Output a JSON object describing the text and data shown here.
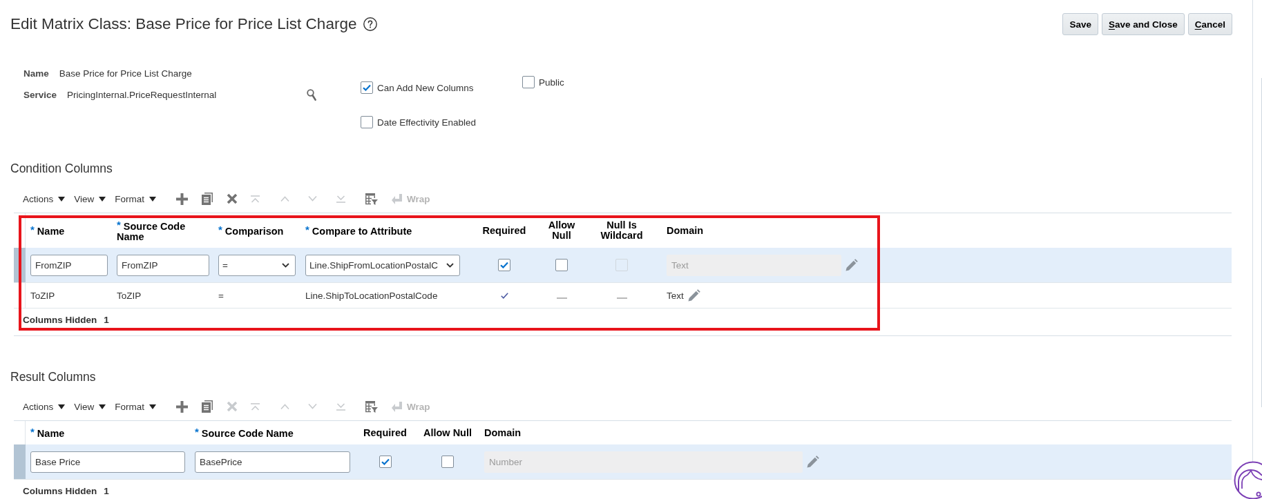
{
  "page": {
    "title": "Edit Matrix Class: Base Price for Price List Charge"
  },
  "buttons": [
    {
      "label": "Save",
      "mnemonic": false
    },
    {
      "label": "Save and Close",
      "mnemonic": true
    },
    {
      "label": "Cancel",
      "mnemonic": true
    }
  ],
  "form": {
    "fields": [
      {
        "kind": "text",
        "label": "Name",
        "value": "Base Price for Price List Charge"
      },
      {
        "kind": "lookup",
        "label": "Service",
        "value": "PricingInternal.PriceRequestInternal"
      }
    ],
    "option_groups": [
      {
        "options": [
          {
            "label": "Can Add New Columns",
            "checked": true
          },
          {
            "label": "Date Effectivity Enabled",
            "checked": false
          }
        ]
      },
      {
        "options": [
          {
            "label": "Public",
            "checked": false
          }
        ]
      }
    ]
  },
  "condition_columns": {
    "title": "Condition Columns",
    "highlighted": true,
    "toolbar": {
      "menus": [
        "Actions",
        "View",
        "Format"
      ],
      "tools": [
        {
          "kind": "add",
          "disabled": false
        },
        {
          "kind": "duplicate",
          "disabled": false
        },
        {
          "kind": "delete",
          "disabled": false
        },
        {
          "kind": "move_top",
          "disabled": true
        },
        {
          "kind": "move_up",
          "disabled": true
        },
        {
          "kind": "move_down",
          "disabled": true
        },
        {
          "kind": "move_bottom",
          "disabled": true
        },
        {
          "kind": "freeze",
          "disabled": false
        }
      ],
      "wrap": {
        "label": "Wrap",
        "disabled": true
      }
    },
    "columns": [
      {
        "kind": "text",
        "marker": "*",
        "label": "Name"
      },
      {
        "kind": "text",
        "marker": "*",
        "label": "Source Code Name"
      },
      {
        "kind": "select",
        "marker": "*",
        "label": "Comparison"
      },
      {
        "kind": "select",
        "marker": "*",
        "label": "Compare to Attribute"
      },
      {
        "kind": "check",
        "label": "Required"
      },
      {
        "kind": "check",
        "label": "Allow Null"
      },
      {
        "kind": "check",
        "label": "Null Is Wildcard"
      },
      {
        "kind": "domain",
        "label": "Domain"
      }
    ],
    "rows": [
      {
        "selected": true,
        "cells": [
          {
            "value": "FromZIP"
          },
          {
            "value": "FromZIP"
          },
          {
            "value": "="
          },
          {
            "value": "Line.ShipFromLocationPostalC"
          },
          {
            "checked": true,
            "disabled": false
          },
          {
            "checked": false,
            "disabled": false
          },
          {
            "checked": false,
            "disabled": true
          },
          {
            "value": "Text"
          }
        ]
      },
      {
        "selected": false,
        "cells": [
          {
            "value": "ToZIP"
          },
          {
            "value": "ToZIP"
          },
          {
            "value": "="
          },
          {
            "value": "Line.ShipToLocationPostalCode"
          },
          {
            "checked": true,
            "disabled": false
          },
          {
            "checked": false,
            "disabled": false
          },
          {
            "checked": false,
            "disabled": false
          },
          {
            "value": "Text"
          }
        ]
      }
    ],
    "footer": {
      "label": "Columns Hidden",
      "count": "1"
    }
  },
  "result_columns": {
    "title": "Result Columns",
    "toolbar": {
      "menus": [
        "Actions",
        "View",
        "Format"
      ],
      "tools": [
        {
          "kind": "add",
          "disabled": false
        },
        {
          "kind": "duplicate",
          "disabled": false
        },
        {
          "kind": "delete",
          "disabled": true
        },
        {
          "kind": "move_top",
          "disabled": true
        },
        {
          "kind": "move_up",
          "disabled": true
        },
        {
          "kind": "move_down",
          "disabled": true
        },
        {
          "kind": "move_bottom",
          "disabled": true
        },
        {
          "kind": "freeze",
          "disabled": false
        }
      ],
      "wrap": {
        "label": "Wrap",
        "disabled": true
      }
    },
    "columns": [
      {
        "kind": "text",
        "marker": "*",
        "label": "Name"
      },
      {
        "kind": "text",
        "marker": "*",
        "label": "Source Code Name"
      },
      {
        "kind": "check",
        "label": "Required"
      },
      {
        "kind": "check",
        "label": "Allow Null"
      },
      {
        "kind": "domain",
        "label": "Domain"
      }
    ],
    "rows": [
      {
        "selected": true,
        "cells": [
          {
            "value": "Base Price"
          },
          {
            "value": "BasePrice"
          },
          {
            "checked": true,
            "disabled": false
          },
          {
            "checked": false,
            "disabled": false
          },
          {
            "value": "Number"
          }
        ]
      }
    ],
    "footer": {
      "label": "Columns Hidden",
      "count": "1"
    }
  }
}
